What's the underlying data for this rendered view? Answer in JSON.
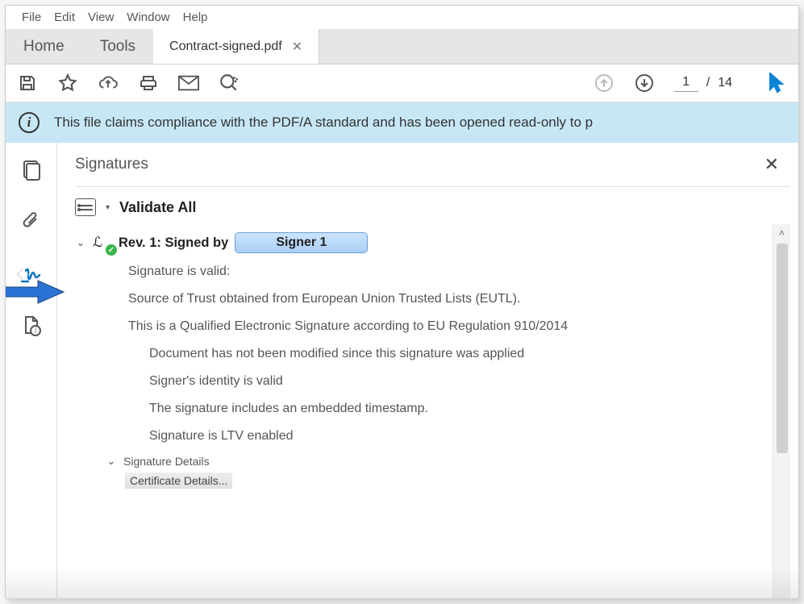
{
  "menu": {
    "items": [
      "File",
      "Edit",
      "View",
      "Window",
      "Help"
    ]
  },
  "tabs": {
    "home": "Home",
    "tools": "Tools",
    "doc": "Contract-signed.pdf"
  },
  "page": {
    "current": "1",
    "sep": "/",
    "total": "14"
  },
  "banner": {
    "text": "This file claims compliance with the PDF/A standard and has been opened read-only to p"
  },
  "panel": {
    "title": "Signatures",
    "validate_all": "Validate All",
    "rev_prefix": "Rev. 1: Signed by",
    "signer_badge": "Signer 1",
    "lines": {
      "valid": "Signature is valid:",
      "source": "Source of Trust obtained from European Union Trusted Lists (EUTL).",
      "qes": "This is a Qualified Electronic Signature according to EU Regulation 910/2014",
      "notmod": "Document has not been modified since this signature was applied",
      "identity": "Signer's identity is valid",
      "timestamp": "The signature includes an embedded timestamp.",
      "ltv": "Signature is LTV enabled"
    },
    "sig_details": "Signature Details",
    "cert_details": "Certificate Details..."
  }
}
